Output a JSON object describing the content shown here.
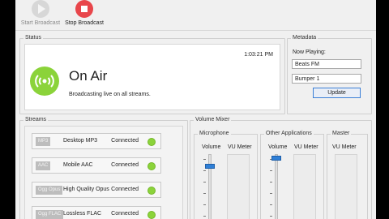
{
  "toolbar": {
    "start_label": "Start Broadcast",
    "stop_label": "Stop Broadcast"
  },
  "status": {
    "group_title": "Status",
    "time": "1:03:21 PM",
    "state": "On Air",
    "message": "Broadcasting live on all streams."
  },
  "metadata": {
    "group_title": "Metadata",
    "now_playing_label": "Now Playing:",
    "field1": "Beats FM",
    "field2": "Bumper 1",
    "update_label": "Update"
  },
  "streams": {
    "group_title": "Streams",
    "items": [
      {
        "format": "MP3",
        "name": "Desktop MP3",
        "status": "Connected"
      },
      {
        "format": "AAC",
        "name": "Mobile AAC",
        "status": "Connected"
      },
      {
        "format": "Ogg Opus",
        "name": "High Quality Opus",
        "status": "Connected"
      },
      {
        "format": "Ogg FLAC",
        "name": "Lossless FLAC",
        "status": "Connected"
      }
    ]
  },
  "mixer": {
    "group_title": "Volume Mixer",
    "channels": [
      {
        "title": "Microphone",
        "volume_label": "Volume",
        "meter_label": "VU Meter",
        "volume_level": 0.75
      },
      {
        "title": "Other Applications",
        "volume_label": "Volume",
        "meter_label": "VU Meter",
        "volume_level": 0.9
      },
      {
        "title": "Master",
        "meter_label": "VU Meter"
      }
    ]
  },
  "colors": {
    "on_air": "#8bd33a",
    "stop": "#e8464b",
    "accent": "#2f7fd6"
  }
}
